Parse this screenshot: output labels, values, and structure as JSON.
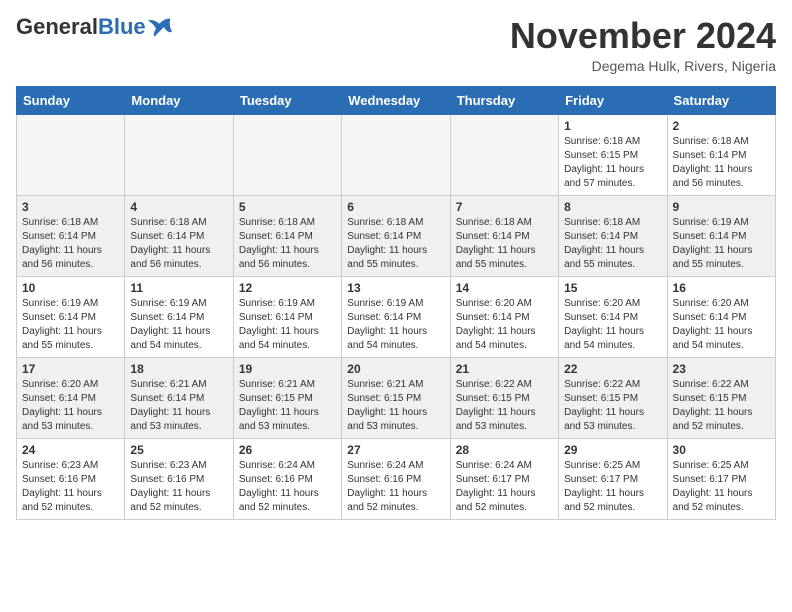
{
  "logo": {
    "general": "General",
    "blue": "Blue"
  },
  "header": {
    "month": "November 2024",
    "location": "Degema Hulk, Rivers, Nigeria"
  },
  "weekdays": [
    "Sunday",
    "Monday",
    "Tuesday",
    "Wednesday",
    "Thursday",
    "Friday",
    "Saturday"
  ],
  "weeks": [
    [
      {
        "day": "",
        "empty": true
      },
      {
        "day": "",
        "empty": true
      },
      {
        "day": "",
        "empty": true
      },
      {
        "day": "",
        "empty": true
      },
      {
        "day": "",
        "empty": true
      },
      {
        "day": "1",
        "sunrise": "Sunrise: 6:18 AM",
        "sunset": "Sunset: 6:15 PM",
        "daylight": "Daylight: 11 hours and 57 minutes."
      },
      {
        "day": "2",
        "sunrise": "Sunrise: 6:18 AM",
        "sunset": "Sunset: 6:14 PM",
        "daylight": "Daylight: 11 hours and 56 minutes."
      }
    ],
    [
      {
        "day": "3",
        "sunrise": "Sunrise: 6:18 AM",
        "sunset": "Sunset: 6:14 PM",
        "daylight": "Daylight: 11 hours and 56 minutes."
      },
      {
        "day": "4",
        "sunrise": "Sunrise: 6:18 AM",
        "sunset": "Sunset: 6:14 PM",
        "daylight": "Daylight: 11 hours and 56 minutes."
      },
      {
        "day": "5",
        "sunrise": "Sunrise: 6:18 AM",
        "sunset": "Sunset: 6:14 PM",
        "daylight": "Daylight: 11 hours and 56 minutes."
      },
      {
        "day": "6",
        "sunrise": "Sunrise: 6:18 AM",
        "sunset": "Sunset: 6:14 PM",
        "daylight": "Daylight: 11 hours and 55 minutes."
      },
      {
        "day": "7",
        "sunrise": "Sunrise: 6:18 AM",
        "sunset": "Sunset: 6:14 PM",
        "daylight": "Daylight: 11 hours and 55 minutes."
      },
      {
        "day": "8",
        "sunrise": "Sunrise: 6:18 AM",
        "sunset": "Sunset: 6:14 PM",
        "daylight": "Daylight: 11 hours and 55 minutes."
      },
      {
        "day": "9",
        "sunrise": "Sunrise: 6:19 AM",
        "sunset": "Sunset: 6:14 PM",
        "daylight": "Daylight: 11 hours and 55 minutes."
      }
    ],
    [
      {
        "day": "10",
        "sunrise": "Sunrise: 6:19 AM",
        "sunset": "Sunset: 6:14 PM",
        "daylight": "Daylight: 11 hours and 55 minutes."
      },
      {
        "day": "11",
        "sunrise": "Sunrise: 6:19 AM",
        "sunset": "Sunset: 6:14 PM",
        "daylight": "Daylight: 11 hours and 54 minutes."
      },
      {
        "day": "12",
        "sunrise": "Sunrise: 6:19 AM",
        "sunset": "Sunset: 6:14 PM",
        "daylight": "Daylight: 11 hours and 54 minutes."
      },
      {
        "day": "13",
        "sunrise": "Sunrise: 6:19 AM",
        "sunset": "Sunset: 6:14 PM",
        "daylight": "Daylight: 11 hours and 54 minutes."
      },
      {
        "day": "14",
        "sunrise": "Sunrise: 6:20 AM",
        "sunset": "Sunset: 6:14 PM",
        "daylight": "Daylight: 11 hours and 54 minutes."
      },
      {
        "day": "15",
        "sunrise": "Sunrise: 6:20 AM",
        "sunset": "Sunset: 6:14 PM",
        "daylight": "Daylight: 11 hours and 54 minutes."
      },
      {
        "day": "16",
        "sunrise": "Sunrise: 6:20 AM",
        "sunset": "Sunset: 6:14 PM",
        "daylight": "Daylight: 11 hours and 54 minutes."
      }
    ],
    [
      {
        "day": "17",
        "sunrise": "Sunrise: 6:20 AM",
        "sunset": "Sunset: 6:14 PM",
        "daylight": "Daylight: 11 hours and 53 minutes."
      },
      {
        "day": "18",
        "sunrise": "Sunrise: 6:21 AM",
        "sunset": "Sunset: 6:14 PM",
        "daylight": "Daylight: 11 hours and 53 minutes."
      },
      {
        "day": "19",
        "sunrise": "Sunrise: 6:21 AM",
        "sunset": "Sunset: 6:15 PM",
        "daylight": "Daylight: 11 hours and 53 minutes."
      },
      {
        "day": "20",
        "sunrise": "Sunrise: 6:21 AM",
        "sunset": "Sunset: 6:15 PM",
        "daylight": "Daylight: 11 hours and 53 minutes."
      },
      {
        "day": "21",
        "sunrise": "Sunrise: 6:22 AM",
        "sunset": "Sunset: 6:15 PM",
        "daylight": "Daylight: 11 hours and 53 minutes."
      },
      {
        "day": "22",
        "sunrise": "Sunrise: 6:22 AM",
        "sunset": "Sunset: 6:15 PM",
        "daylight": "Daylight: 11 hours and 53 minutes."
      },
      {
        "day": "23",
        "sunrise": "Sunrise: 6:22 AM",
        "sunset": "Sunset: 6:15 PM",
        "daylight": "Daylight: 11 hours and 52 minutes."
      }
    ],
    [
      {
        "day": "24",
        "sunrise": "Sunrise: 6:23 AM",
        "sunset": "Sunset: 6:16 PM",
        "daylight": "Daylight: 11 hours and 52 minutes."
      },
      {
        "day": "25",
        "sunrise": "Sunrise: 6:23 AM",
        "sunset": "Sunset: 6:16 PM",
        "daylight": "Daylight: 11 hours and 52 minutes."
      },
      {
        "day": "26",
        "sunrise": "Sunrise: 6:24 AM",
        "sunset": "Sunset: 6:16 PM",
        "daylight": "Daylight: 11 hours and 52 minutes."
      },
      {
        "day": "27",
        "sunrise": "Sunrise: 6:24 AM",
        "sunset": "Sunset: 6:16 PM",
        "daylight": "Daylight: 11 hours and 52 minutes."
      },
      {
        "day": "28",
        "sunrise": "Sunrise: 6:24 AM",
        "sunset": "Sunset: 6:17 PM",
        "daylight": "Daylight: 11 hours and 52 minutes."
      },
      {
        "day": "29",
        "sunrise": "Sunrise: 6:25 AM",
        "sunset": "Sunset: 6:17 PM",
        "daylight": "Daylight: 11 hours and 52 minutes."
      },
      {
        "day": "30",
        "sunrise": "Sunrise: 6:25 AM",
        "sunset": "Sunset: 6:17 PM",
        "daylight": "Daylight: 11 hours and 52 minutes."
      }
    ]
  ]
}
